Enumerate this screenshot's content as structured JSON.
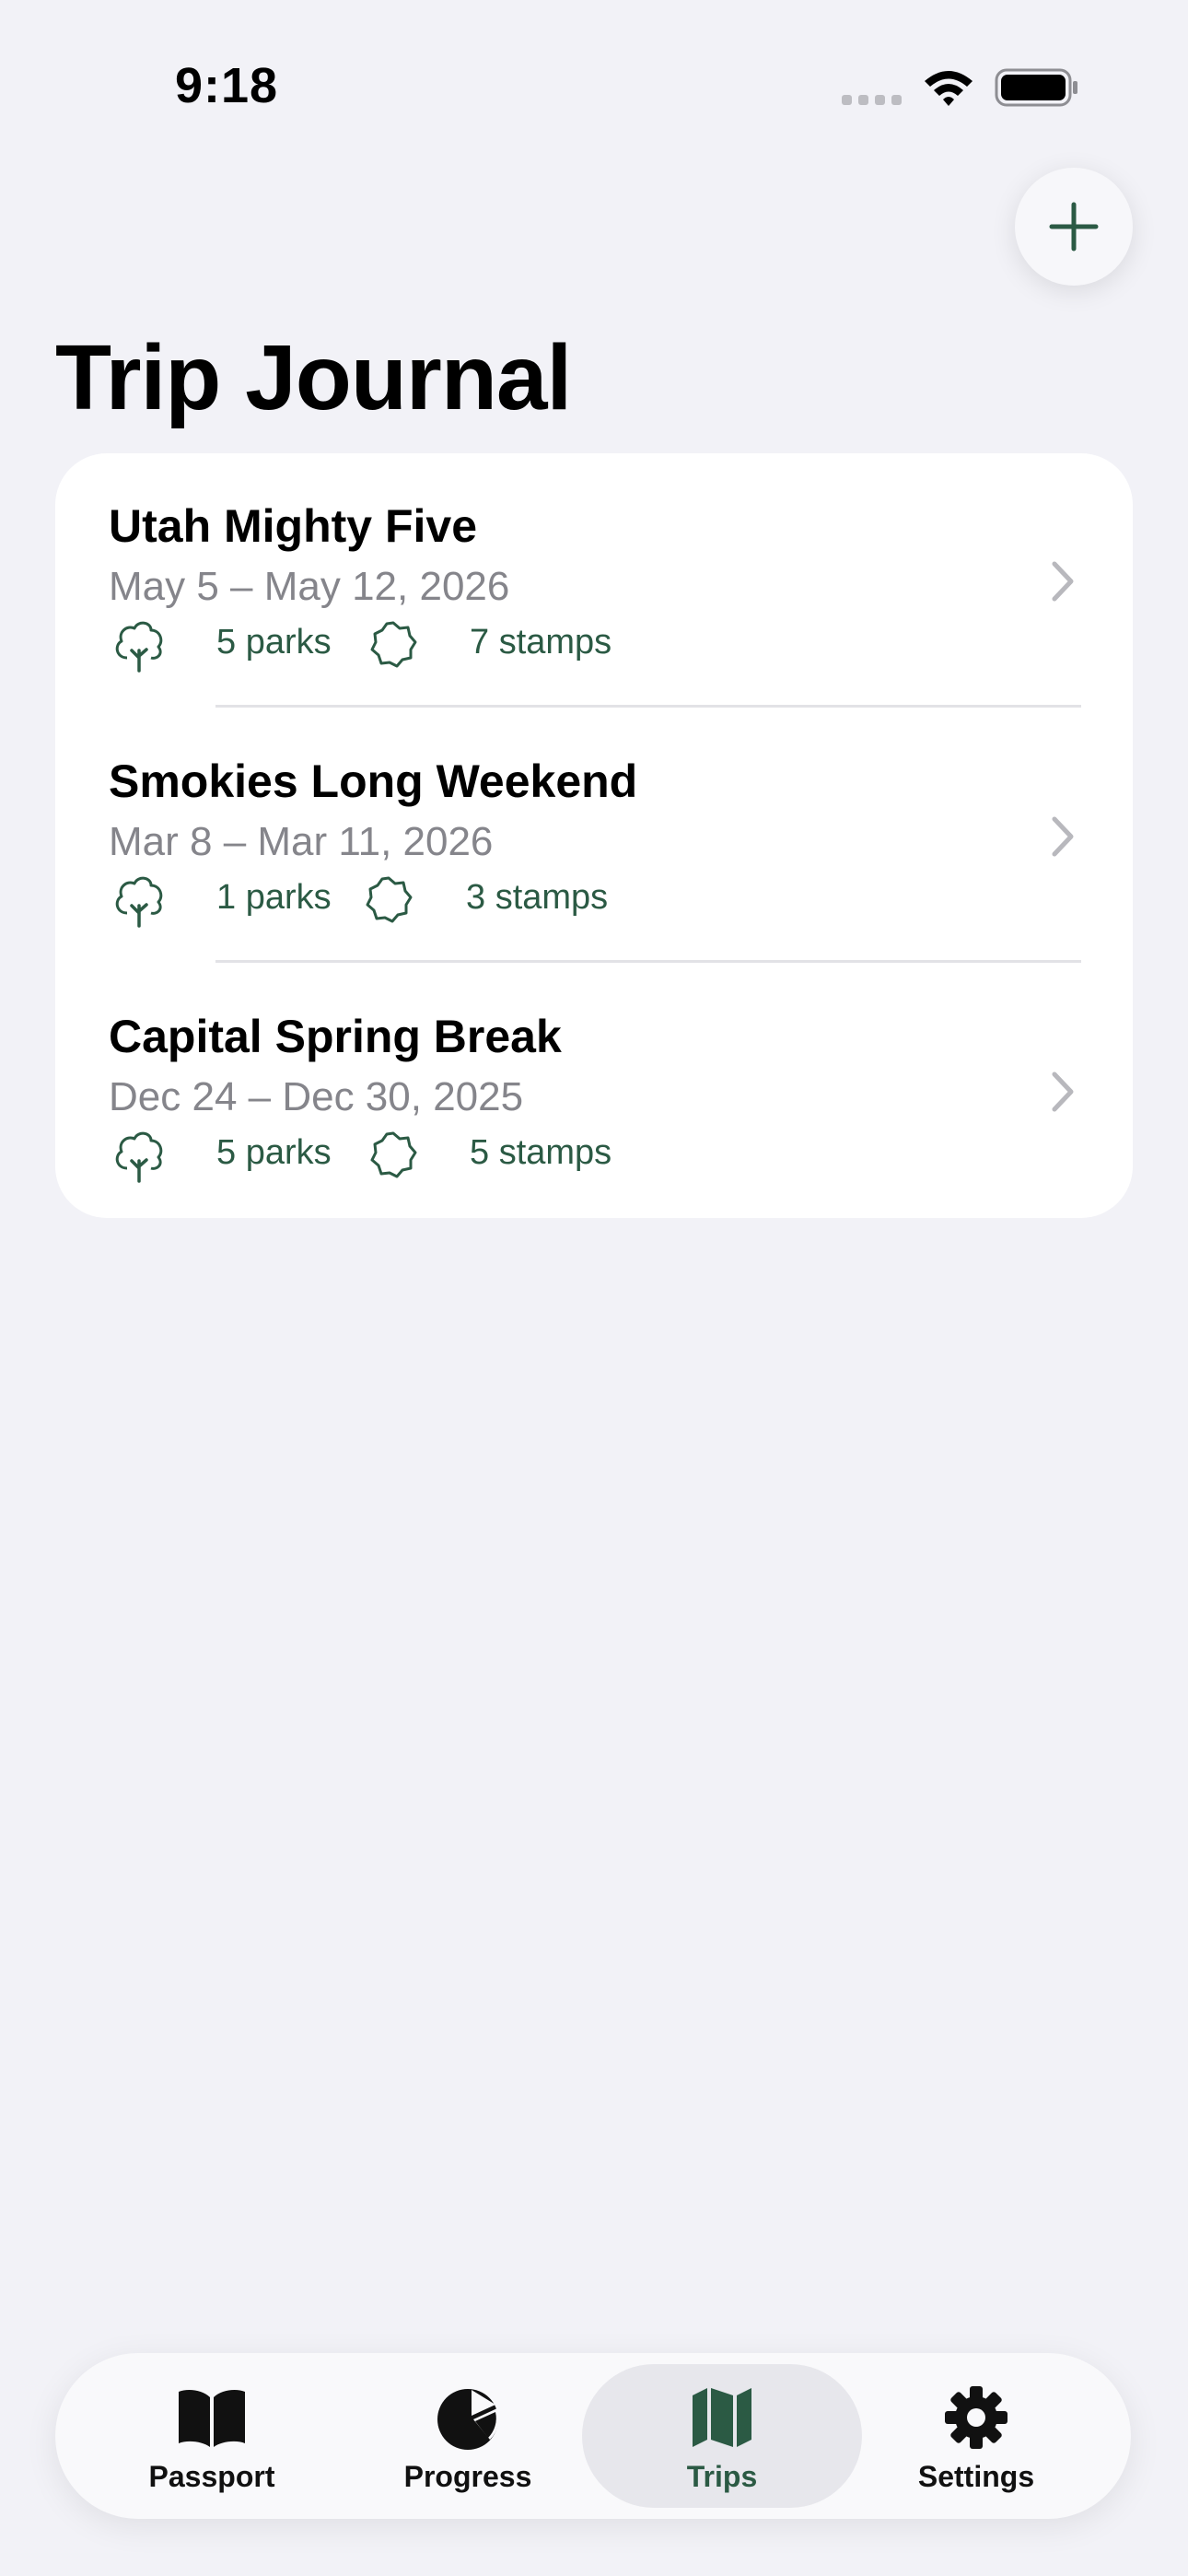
{
  "status_bar": {
    "time": "9:18"
  },
  "header": {
    "title": "Trip Journal"
  },
  "colors": {
    "accent": "#2b5a44",
    "background": "#f2f2f7",
    "card": "#ffffff",
    "secondary_text": "#85858b"
  },
  "trips": [
    {
      "name": "Utah Mighty Five",
      "dates": "May 5 – May 12, 2026",
      "parks": "5 parks",
      "stamps": "7 stamps"
    },
    {
      "name": "Smokies Long Weekend",
      "dates": "Mar 8 – Mar 11, 2026",
      "parks": "1 parks",
      "stamps": "3 stamps"
    },
    {
      "name": "Capital Spring Break",
      "dates": "Dec 24 – Dec 30, 2025",
      "parks": "5 parks",
      "stamps": "5 stamps"
    }
  ],
  "tab_bar": {
    "tabs": [
      {
        "label": "Passport",
        "icon": "book-icon"
      },
      {
        "label": "Progress",
        "icon": "pie-chart-icon"
      },
      {
        "label": "Trips",
        "icon": "map-icon",
        "selected": true
      },
      {
        "label": "Settings",
        "icon": "gear-icon"
      }
    ]
  }
}
